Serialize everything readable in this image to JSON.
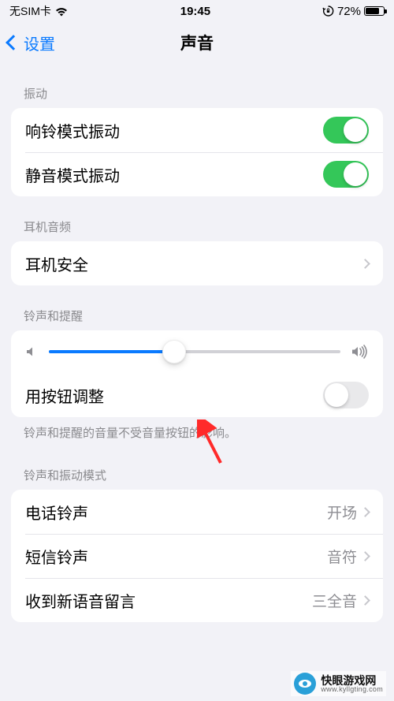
{
  "status": {
    "sim": "无SIM卡",
    "time": "19:45",
    "lock": "⦿",
    "battery_pct": "72%"
  },
  "nav": {
    "back": "设置",
    "title": "声音"
  },
  "sections": {
    "vibration": {
      "header": "振动",
      "ring_vibrate": "响铃模式振动",
      "silent_vibrate": "静音模式振动",
      "ring_on": true,
      "silent_on": true
    },
    "headphone": {
      "header": "耳机音频",
      "safety": "耳机安全"
    },
    "ringer": {
      "header": "铃声和提醒",
      "volume_pct": 43,
      "change_with_buttons": "用按钮调整",
      "change_on": false,
      "footer": "铃声和提醒的音量不受音量按钮的影响。"
    },
    "patterns": {
      "header": "铃声和振动模式",
      "ringtone": "电话铃声",
      "ringtone_val": "开场",
      "text_tone": "短信铃声",
      "text_tone_val": "音符",
      "voicemail": "收到新语音留言",
      "voicemail_val": "三全音"
    }
  },
  "watermark": {
    "title": "快眼游戏网",
    "url": "www.kyllgting.com"
  }
}
